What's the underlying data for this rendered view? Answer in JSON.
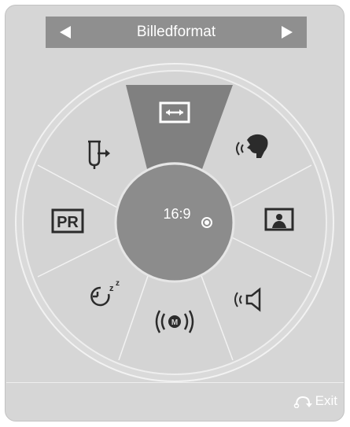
{
  "header": {
    "title": "Billedformat"
  },
  "wheel": {
    "center_value": "16:9",
    "center_icon": "radio-dot-icon",
    "items": [
      {
        "icon": "aspect-ratio-icon",
        "selected": true
      },
      {
        "icon": "voice-icon",
        "selected": false
      },
      {
        "icon": "picture-mode-icon",
        "selected": false
      },
      {
        "icon": "sound-mode-icon",
        "selected": false
      },
      {
        "icon": "mts-icon",
        "selected": false
      },
      {
        "icon": "sleep-timer-icon",
        "selected": false
      },
      {
        "icon": "pr-icon",
        "selected": false
      },
      {
        "icon": "input-icon",
        "selected": false
      }
    ]
  },
  "footer": {
    "exit_label": "Exit",
    "exit_icon": "return-icon"
  },
  "colors": {
    "panel": "#d6d6d6",
    "titlebar": "#8f8f8f",
    "selected_segment": "#808080",
    "center_circle": "#8c8c8c",
    "icon": "#2b2b2b",
    "text": "#ffffff"
  }
}
